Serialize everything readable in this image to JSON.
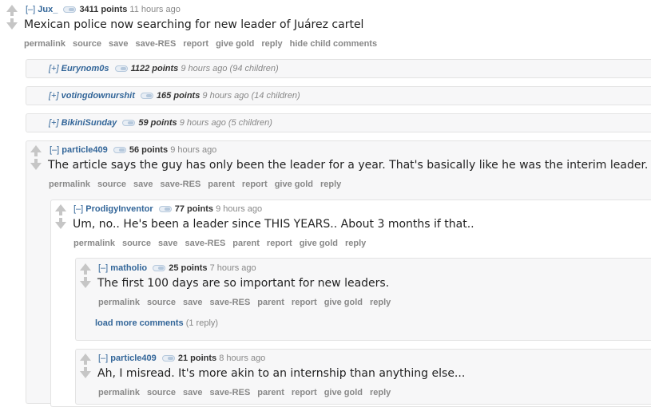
{
  "comments": {
    "top": {
      "expander": "[–]",
      "author": "Jux_",
      "points": "3411 points",
      "time": "11 hours ago",
      "body": "Mexican police now searching for new leader of Juárez cartel",
      "buttons": [
        "permalink",
        "source",
        "save",
        "save-RES",
        "report",
        "give gold",
        "reply",
        "hide child comments"
      ]
    },
    "collapsed": [
      {
        "expander": "[+]",
        "author": "Eurynom0s",
        "points": "1122 points",
        "time": "9 hours ago",
        "children": "(94 children)"
      },
      {
        "expander": "[+]",
        "author": "votingdownurshit",
        "points": "165 points",
        "time": "9 hours ago",
        "children": "(14 children)"
      },
      {
        "expander": "[+]",
        "author": "BikiniSunday",
        "points": "59 points",
        "time": "9 hours ago",
        "children": "(5 children)"
      }
    ],
    "particle1": {
      "expander": "[–]",
      "author": "particle409",
      "points": "56 points",
      "time": "9 hours ago",
      "body": "The article says the guy has only been the leader for a year. That's basically like he was the interim leader.",
      "buttons": [
        "permalink",
        "source",
        "save",
        "save-RES",
        "parent",
        "report",
        "give gold",
        "reply"
      ]
    },
    "prodigy": {
      "expander": "[–]",
      "author": "ProdigyInventor",
      "points": "77 points",
      "time": "9 hours ago",
      "body": "Um, no.. He's been a leader since THIS YEARS.. About 3 months if that..",
      "buttons": [
        "permalink",
        "source",
        "save",
        "save-RES",
        "parent",
        "report",
        "give gold",
        "reply"
      ]
    },
    "matholio": {
      "expander": "[–]",
      "author": "matholio",
      "points": "25 points",
      "time": "7 hours ago",
      "body": "The first 100 days are so important for new leaders.",
      "buttons": [
        "permalink",
        "source",
        "save",
        "save-RES",
        "parent",
        "report",
        "give gold",
        "reply"
      ],
      "load_more": "load more comments",
      "load_more_count": "(1 reply)"
    },
    "particle2": {
      "expander": "[–]",
      "author": "particle409",
      "points": "21 points",
      "time": "8 hours ago",
      "body": "Ah, I misread. It's more akin to an internship than anything else...",
      "buttons": [
        "permalink",
        "source",
        "save",
        "save-RES",
        "parent",
        "report",
        "give gold",
        "reply"
      ]
    }
  }
}
